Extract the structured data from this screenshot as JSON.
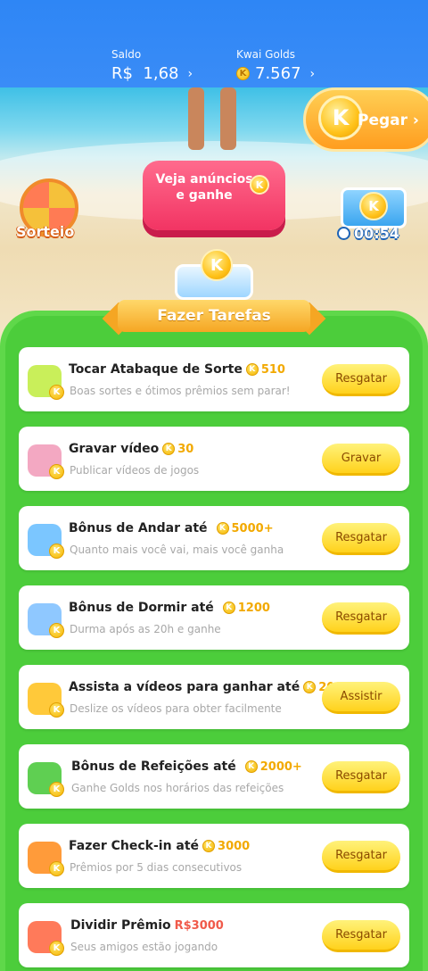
{
  "header": {
    "saldo_label": "Saldo",
    "saldo_value": "R$  1,68",
    "golds_label": "Kwai Golds",
    "golds_value": "7.567"
  },
  "scene": {
    "pegar_label": "Pegar",
    "ads_button": "Veja anúncios e ganhe",
    "sorteio_label": "Sorteio",
    "timer": "00:54"
  },
  "section_title": "Fazer Tarefas",
  "tasks": [
    {
      "title": "Tocar Atabaque de Sorte",
      "reward": "510",
      "subtitle": "Boas sortes e ótimos prêmios sem parar!",
      "button": "Resgatar"
    },
    {
      "title": "Gravar vídeo",
      "reward": "30",
      "subtitle": "Publicar vídeos de jogos",
      "button": "Gravar"
    },
    {
      "title": "Bônus de Andar até",
      "reward": "5000+",
      "subtitle": "Quanto mais você vai, mais você ganha",
      "button": "Resgatar"
    },
    {
      "title": "Bônus de Dormir até",
      "reward": "1200",
      "subtitle": "Durma após as 20h e ganhe",
      "button": "Resgatar"
    },
    {
      "title": "Assista a vídeos para ganhar até",
      "reward": "2000",
      "subtitle": "Deslize os vídeos para obter facilmente",
      "button": "Assistir"
    },
    {
      "title": "Bônus de Refeições até",
      "reward": "2000+",
      "subtitle": "Ganhe Golds nos horários das refeições",
      "button": "Resgatar"
    },
    {
      "title": "Fazer Check-in até",
      "reward": "3000",
      "subtitle": "Prêmios por 5 dias consecutivos",
      "button": "Resgatar"
    },
    {
      "title": "Dividir Prêmio",
      "reward": "R$3000",
      "subtitle": "Seus amigos estão jogando",
      "button": "Resgatar"
    }
  ]
}
